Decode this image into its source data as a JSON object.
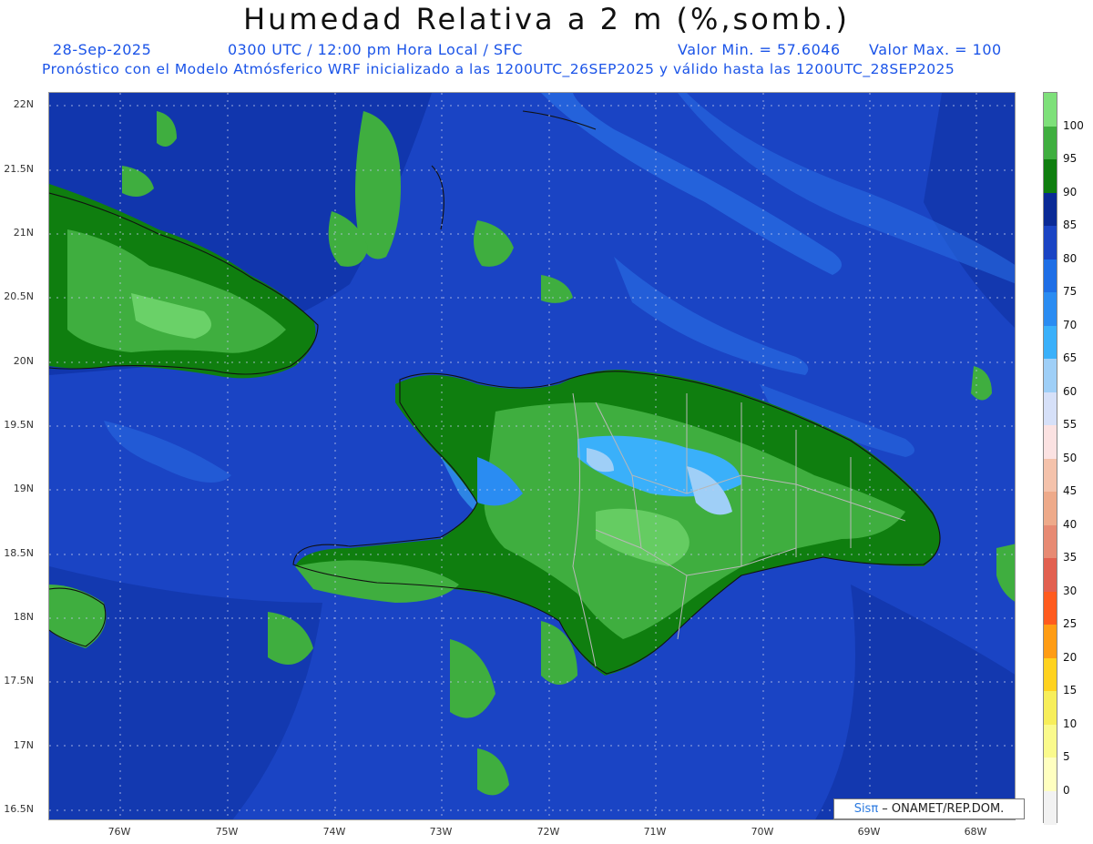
{
  "header": {
    "title": "Humedad Relativa a 2 m (%,somb.)",
    "date": "28-Sep-2025",
    "time": "0300 UTC / 12:00 pm Hora Local / SFC",
    "min": "Valor Min. = 57.6046",
    "max": "Valor Max. = 100",
    "forecast": "Pronóstico con el Modelo Atmósferico WRF inicializado a las 1200UTC_26SEP2025 y válido hasta las  1200UTC_28SEP2025"
  },
  "axes": {
    "lat_labels": [
      "22N",
      "21.5N",
      "21N",
      "20.5N",
      "20N",
      "19.5N",
      "19N",
      "18.5N",
      "18N",
      "17.5N",
      "17N",
      "16.5N"
    ],
    "lon_labels": [
      "76W",
      "75W",
      "74W",
      "73W",
      "72W",
      "71W",
      "70W",
      "69W",
      "68W"
    ]
  },
  "colorbar": {
    "labels": [
      "100",
      "95",
      "90",
      "85",
      "80",
      "75",
      "70",
      "65",
      "60",
      "55",
      "50",
      "45",
      "40",
      "35",
      "30",
      "25",
      "20",
      "15",
      "10",
      "5",
      "0"
    ],
    "colors": [
      "#7ee07a",
      "#3fae3f",
      "#0f7e0f",
      "#0a2a96",
      "#1a44c4",
      "#1e6ee6",
      "#2a8cf2",
      "#3ab0fa",
      "#9fcff7",
      "#d6e0f8",
      "#fbe2e2",
      "#f4c2ab",
      "#eeaa8a",
      "#e78a73",
      "#e26050",
      "#ff5b1e",
      "#ff9c14",
      "#ffd21f",
      "#f7ee5a",
      "#fafa8c",
      "#ffffc0",
      "#f2f2f2"
    ]
  },
  "credit": {
    "brand": "Sisπ",
    "text": " – ONAMET/REP.DOM."
  }
}
